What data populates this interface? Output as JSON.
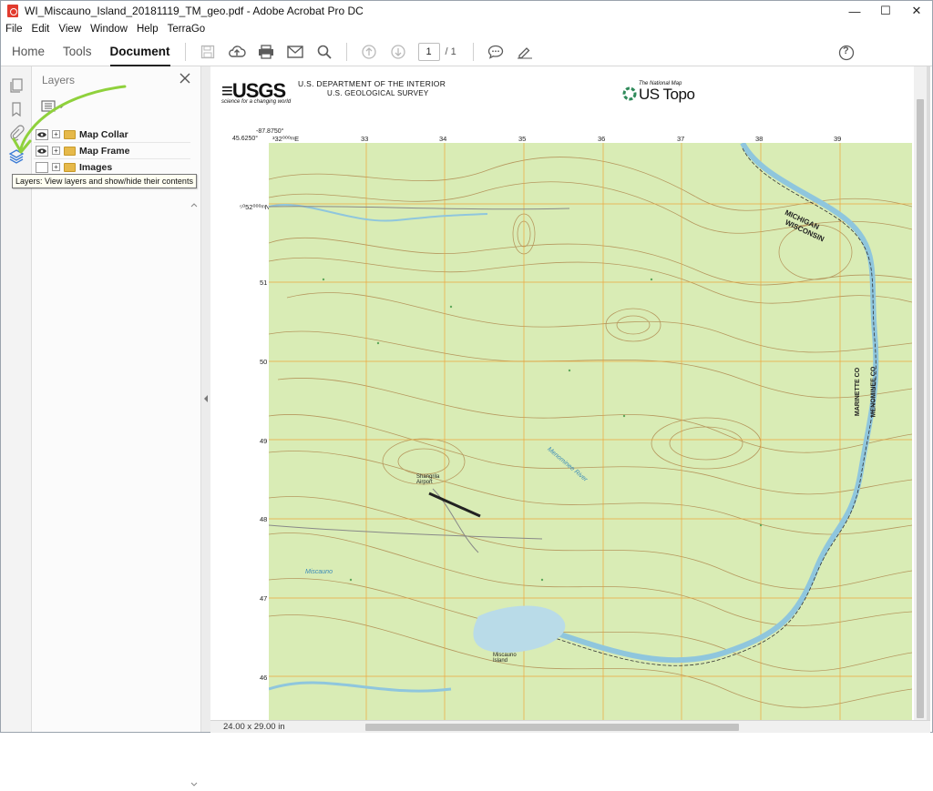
{
  "window": {
    "title": "WI_Miscauno_Island_20181119_TM_geo.pdf - Adobe Acrobat Pro DC",
    "buttons": [
      "—",
      "☐",
      "✕"
    ]
  },
  "menu": [
    "File",
    "Edit",
    "View",
    "Window",
    "Help",
    "TerraGo"
  ],
  "toolbar": {
    "tabs": [
      "Home",
      "Tools",
      "Document"
    ],
    "active_tab": "Document",
    "page_current": "1",
    "page_total": "/ 1",
    "help": "?"
  },
  "layers_panel": {
    "title": "Layers",
    "items": [
      {
        "label": "Map Collar",
        "visible": true
      },
      {
        "label": "Map Frame",
        "visible": true
      },
      {
        "label": "Images",
        "visible": false
      }
    ],
    "tooltip": "Layers: View layers and show/hide their contents"
  },
  "document": {
    "usgs_logo": "≡USGS",
    "usgs_tagline": "science for a changing world",
    "department": "U.S. DEPARTMENT OF THE INTERIOR",
    "survey": "U.S. GEOLOGICAL SURVEY",
    "national_map": "The National Map",
    "us_topo": "US Topo",
    "corner_lon": "-87.8750°",
    "corner_lat": "45.6250°",
    "top_ticks": [
      "³32⁰⁰⁰ᵐE",
      "33",
      "34",
      "35",
      "36",
      "37",
      "38",
      "39"
    ],
    "left_ticks": [
      "⁵⁰52⁰⁰⁰ᵐN",
      "51",
      "50",
      "49",
      "48",
      "47",
      "46"
    ],
    "map_labels": {
      "state_line": "MICHIGAN",
      "state_line2": "WISCONSIN",
      "county": "MARINETTE CO",
      "county2": "MENOMINEE CO",
      "airport": "Shangrila Airport",
      "island": "Miscauno Island",
      "lake": "Miscauno",
      "river": "Menominee River"
    }
  },
  "status": {
    "page_size": "24.00 x 29.00 in"
  },
  "colors": {
    "map_green": "#d9ecb5",
    "contour": "#b08a50",
    "grid": "#f0a030",
    "water": "#b9dbe8",
    "annotation_arrow": "#8fd13c",
    "layers_icon": "#3a7bd5"
  }
}
